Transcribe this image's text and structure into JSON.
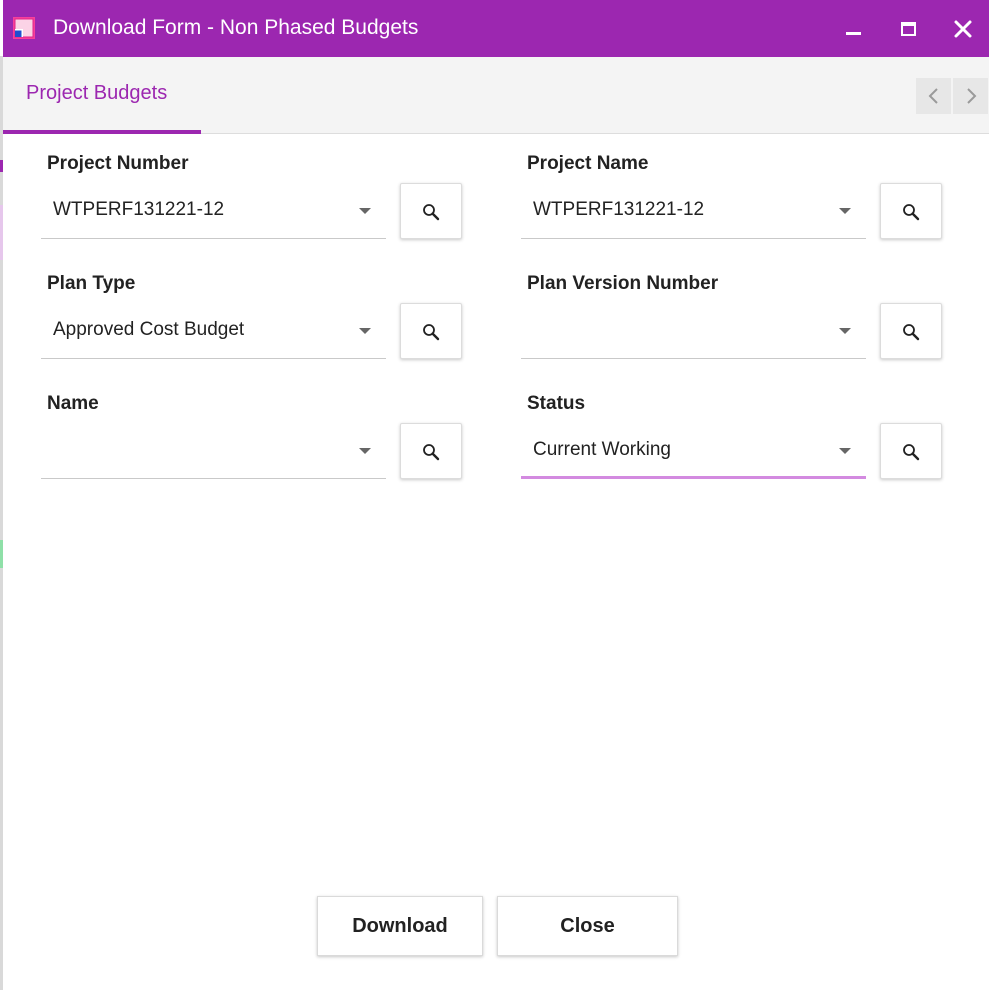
{
  "window": {
    "title": "Download Form - Non Phased Budgets",
    "accent_color": "#9c27b0",
    "controls": [
      "minimize-icon",
      "maximize-icon",
      "close-icon"
    ]
  },
  "tabs": {
    "items": [
      {
        "label": "Project Budgets",
        "active": true
      }
    ],
    "nav": [
      "chevron-left-icon",
      "chevron-right-icon"
    ]
  },
  "fields": {
    "project_number": {
      "label": "Project Number",
      "value": "WTPERF131221-12"
    },
    "project_name": {
      "label": "Project Name",
      "value": "WTPERF131221-12"
    },
    "plan_type": {
      "label": "Plan Type",
      "value": "Approved Cost Budget"
    },
    "plan_version_number": {
      "label": "Plan Version Number",
      "value": ""
    },
    "name": {
      "label": "Name",
      "value": ""
    },
    "status": {
      "label": "Status",
      "value": "Current Working",
      "focused": true
    }
  },
  "actions": {
    "download_label": "Download",
    "close_label": "Close"
  }
}
